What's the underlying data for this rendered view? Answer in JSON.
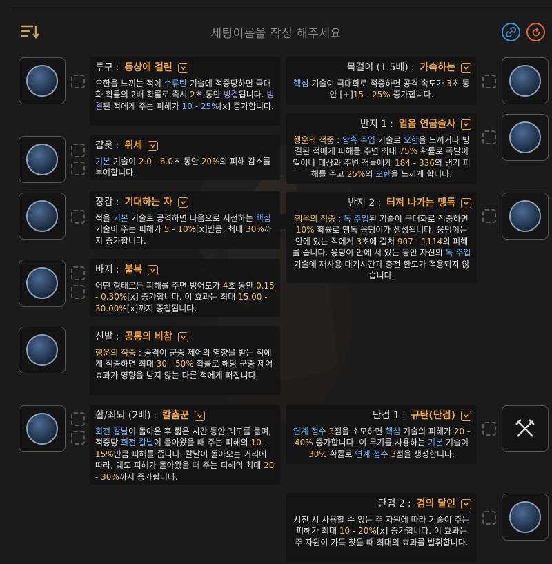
{
  "header": {
    "title": "세팅이름을 작성 해주세요",
    "icons": [
      "sort-list-icon",
      "link-icon",
      "refresh-icon"
    ]
  },
  "colors": {
    "accent": "#f0a63a",
    "blue": "#6cb5ff",
    "purple": "#a99cf0",
    "yellow": "#f0c060",
    "link": "#3b8fd6",
    "refresh": "#e06b2a"
  },
  "left": [
    {
      "slot": "투구",
      "affix": "등상에 걸린",
      "parts": [
        [
          "g",
          "오한을 느끼는 적이 "
        ],
        [
          "b",
          "수류탄"
        ],
        [
          "g",
          " 기술에 적중당하면 극대화 확률의 2배 확률로 즉시 "
        ],
        [
          "y",
          "2"
        ],
        [
          "g",
          "초 동안 "
        ],
        [
          "p",
          "빙결"
        ],
        [
          "g",
          "됩니다. "
        ],
        [
          "p",
          "빙결"
        ],
        [
          "g",
          "된 적에게 주는 피해가 "
        ],
        [
          "b",
          "10 - 25%"
        ],
        [
          "g",
          "[x] 증가합니다."
        ]
      ]
    },
    {
      "slot": "갑옷",
      "affix": "위세",
      "parts": [
        [
          "b",
          "기본"
        ],
        [
          "g",
          " 기술이 "
        ],
        [
          "y",
          "2.0 - 6.0"
        ],
        [
          "g",
          "초 동안 "
        ],
        [
          "y",
          "20%"
        ],
        [
          "g",
          "의 피해 감소를 부여합니다."
        ]
      ]
    },
    {
      "slot": "장갑",
      "affix": "기대하는 자",
      "parts": [
        [
          "g",
          "적을 "
        ],
        [
          "b",
          "기본"
        ],
        [
          "g",
          " 기술로 공격하면 다음으로 시전하는 "
        ],
        [
          "b",
          "핵심"
        ],
        [
          "g",
          " 기술이 주는 피해가 "
        ],
        [
          "y",
          "5 - 10%"
        ],
        [
          "g",
          "[x]만큼, 최대 "
        ],
        [
          "y",
          "30%"
        ],
        [
          "g",
          "까지 증가합니다."
        ]
      ]
    },
    {
      "slot": "바지",
      "affix": "불복",
      "parts": [
        [
          "g",
          "어떤 형태로든 피해를 주면 방어도가 "
        ],
        [
          "y",
          "4"
        ],
        [
          "g",
          "초 동안 "
        ],
        [
          "y",
          "0.15 - 0.30%"
        ],
        [
          "g",
          "[x] 증가합니다. 이 효과는 최대 "
        ],
        [
          "y",
          "15.00 - 30.00%"
        ],
        [
          "g",
          "[x]까지 중첩됩니다."
        ]
      ]
    },
    {
      "slot": "신발",
      "affix": "공통의 비참",
      "parts": [
        [
          "y",
          "행운의 적중"
        ],
        [
          "g",
          " : 공격이 군중 제어의 영향을 받는 적에게 적중하면 최대 "
        ],
        [
          "y",
          "30 - 50%"
        ],
        [
          "g",
          " 확률로 해당 군중 제어 효과가 영향을 받지 않는 다른 적에게 퍼집니다."
        ]
      ]
    },
    {
      "slot": "활/쇠뇌 (2배)",
      "affix": "칼춤꾼",
      "parts": [
        [
          "b",
          "회전 칼날"
        ],
        [
          "g",
          "이 돌아온 후 짧은 시간 동안 궤도를 돌며, 적중당 "
        ],
        [
          "b",
          "회전 칼날"
        ],
        [
          "g",
          "이 돌아왔을 때 주는 피해의 "
        ],
        [
          "y",
          "10 - 15%"
        ],
        [
          "g",
          "만큼 피해를 줍니다. 칼날이 돌아오는 거리에 따라, 궤도 피해가 돌아왔을 때 주는 피해의 최대 "
        ],
        [
          "y",
          "20 - 30%"
        ],
        [
          "g",
          "까지 증가합니다."
        ]
      ]
    }
  ],
  "right": [
    {
      "slot": "목걸이 (1.5배)",
      "affix": "가속하는",
      "parts": [
        [
          "b",
          "핵심"
        ],
        [
          "g",
          " 기술이 극대화로 적중하면 공격 속도가 "
        ],
        [
          "y",
          "3"
        ],
        [
          "g",
          "초 동안 [+]"
        ],
        [
          "y",
          "15 - 25%"
        ],
        [
          "g",
          " 증가합니다."
        ]
      ]
    },
    {
      "slot": "반지 1",
      "affix": "얼음 연금술사",
      "parts": [
        [
          "y",
          "행운의 적중"
        ],
        [
          "g",
          " : "
        ],
        [
          "b",
          "암흑 주입"
        ],
        [
          "g",
          " 기술로 "
        ],
        [
          "b",
          "오한"
        ],
        [
          "g",
          "을 느끼거나 빙결된 적에게 피해를 주면 최대 "
        ],
        [
          "y",
          "75%"
        ],
        [
          "g",
          " 확률로 폭발이 일어나 대상과 주변 적들에게 "
        ],
        [
          "y",
          "184 - 336"
        ],
        [
          "g",
          "의 냉기 피해를 주고 "
        ],
        [
          "y",
          "25%"
        ],
        [
          "g",
          "의 "
        ],
        [
          "b",
          "오한"
        ],
        [
          "g",
          "을 느끼게 합니다."
        ]
      ]
    },
    {
      "slot": "반지 2",
      "affix": "터져 나가는 맹독",
      "parts": [
        [
          "y",
          "행운의 적중"
        ],
        [
          "g",
          " : "
        ],
        [
          "b",
          "독 주입"
        ],
        [
          "g",
          "된 기술이 극대화로 적중하면 "
        ],
        [
          "y",
          "10%"
        ],
        [
          "g",
          " 확률로 맹독 웅덩이가 생성됩니다. 웅덩이는 안에 있는 적에게 "
        ],
        [
          "y",
          "3"
        ],
        [
          "g",
          "초에 걸쳐 "
        ],
        [
          "y",
          "907 - 1114"
        ],
        [
          "g",
          "의 피해를 줍니다. 웅덩이 안에 서 있는 동안 자신의 "
        ],
        [
          "b",
          "독 주입"
        ],
        [
          "g",
          " 기술에 재사용 대기시간과 충전 한도가 적용되지 않습니다."
        ]
      ]
    },
    {
      "slot": "단검 1",
      "affix": "규탄(단검)",
      "parts": [
        [
          "b",
          "연계 점수"
        ],
        [
          "g",
          " "
        ],
        [
          "y",
          "3"
        ],
        [
          "g",
          "점을 소모하면 "
        ],
        [
          "b",
          "핵심"
        ],
        [
          "g",
          " 기술의 피해가 "
        ],
        [
          "y",
          "20 - 40%"
        ],
        [
          "g",
          " 증가합니다. 이 무기를 사용하는 "
        ],
        [
          "b",
          "기본"
        ],
        [
          "g",
          " 기술이 "
        ],
        [
          "y",
          "30%"
        ],
        [
          "g",
          " 확률로 "
        ],
        [
          "b",
          "연계 점수"
        ],
        [
          "g",
          " "
        ],
        [
          "y",
          "3"
        ],
        [
          "g",
          "점을 생성합니다."
        ]
      ]
    },
    {
      "slot": "단검 2",
      "affix": "검의 달인",
      "parts": [
        [
          "g",
          "시전 시 사용할 수 있는 주 자원에 따라 기술이 주는 피해가 최대 "
        ],
        [
          "y",
          "10 - 20%"
        ],
        [
          "g",
          "[x] 증가합니다. 이 효과는 주 자원이 가득 찼을 때 최대의 효과를 발휘합니다."
        ]
      ]
    }
  ]
}
